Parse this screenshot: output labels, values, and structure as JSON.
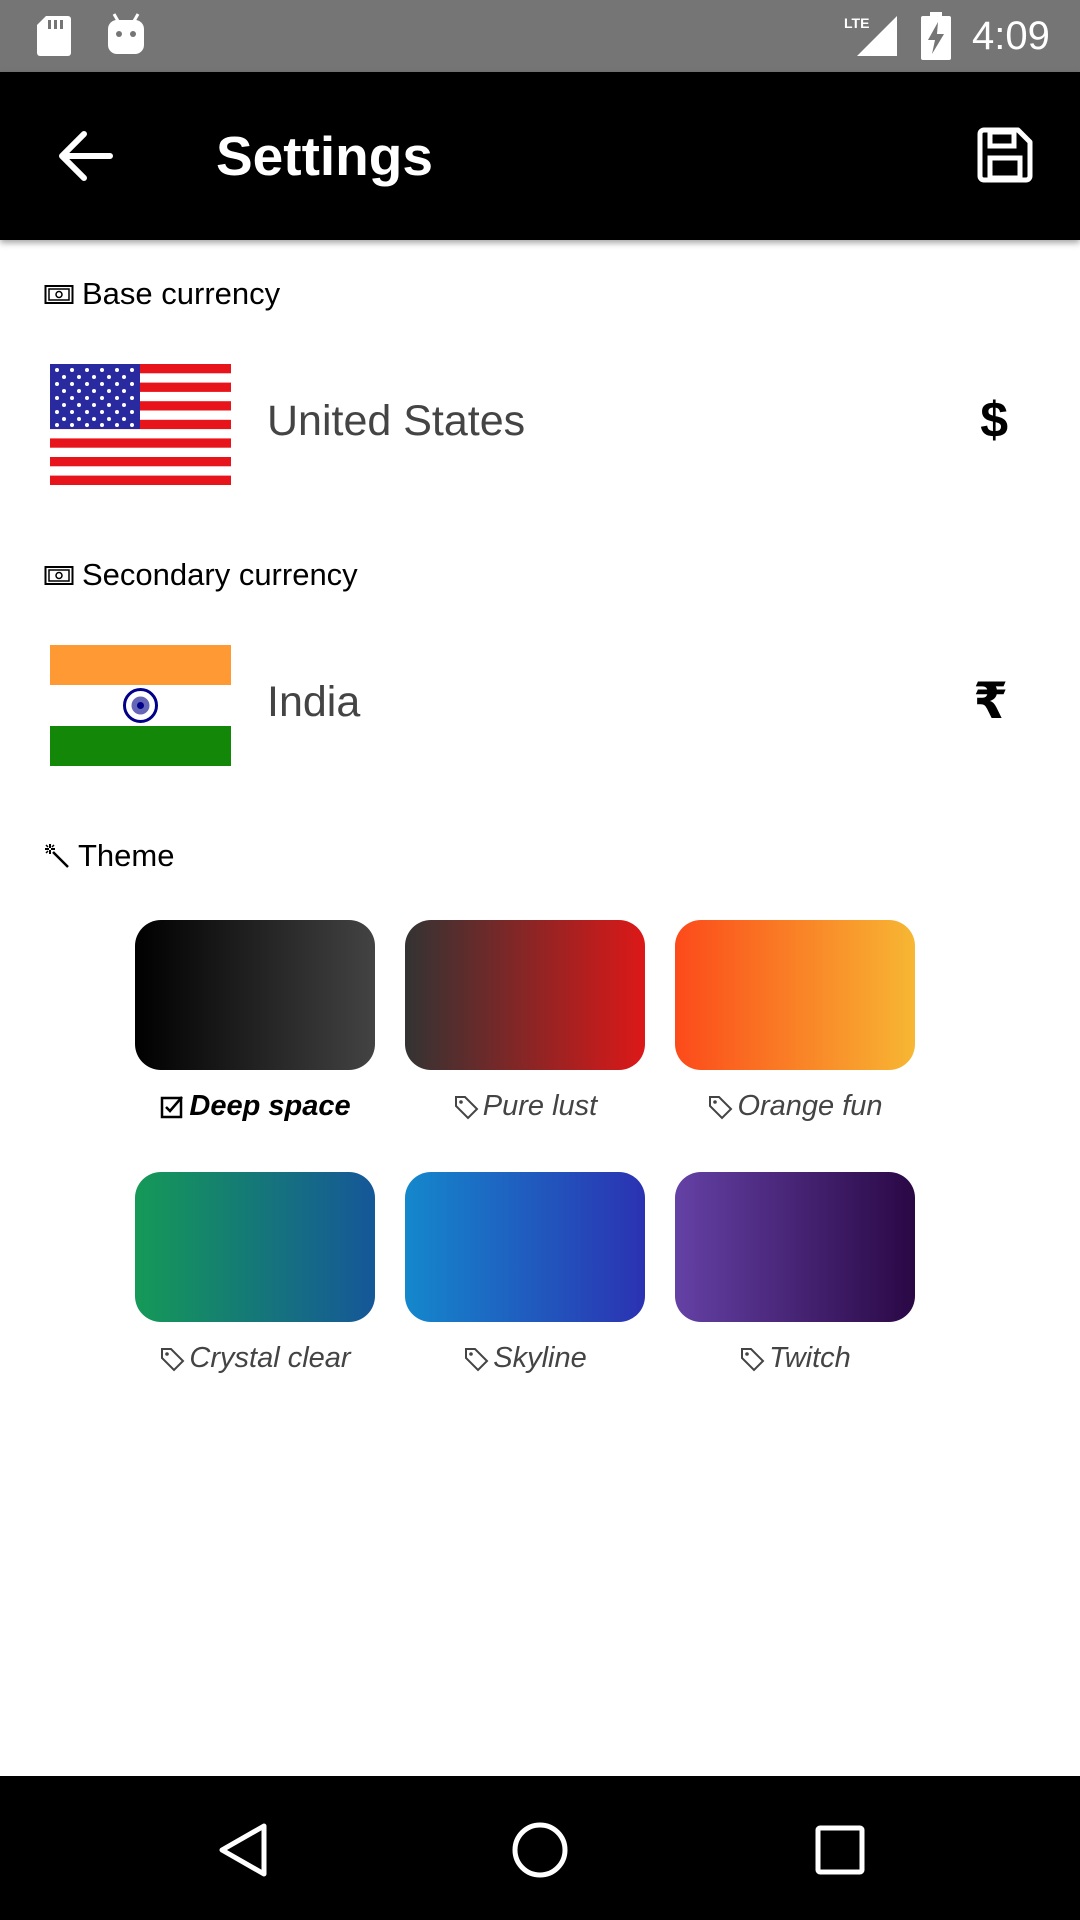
{
  "status_bar": {
    "time": "4:09",
    "network": "LTE",
    "icons": [
      "sd-card-icon",
      "android-icon",
      "lte-signal-icon",
      "battery-charging-icon"
    ]
  },
  "app_bar": {
    "title": "Settings",
    "back_icon": "arrow-back-icon",
    "save_icon": "save-icon"
  },
  "base_currency": {
    "label": "Base currency",
    "icon": "money-icon",
    "country": "United States",
    "symbol": "$",
    "flag": "us-flag"
  },
  "secondary_currency": {
    "label": "Secondary currency",
    "icon": "money-icon",
    "country": "India",
    "symbol": "₹",
    "flag": "india-flag"
  },
  "theme": {
    "label": "Theme",
    "icon": "magic-wand-icon",
    "items": [
      {
        "name": "Deep space",
        "selected": true,
        "from": "#000000",
        "to": "#434343"
      },
      {
        "name": "Pure lust",
        "selected": false,
        "from": "#333333",
        "to": "#dd1818"
      },
      {
        "name": "Orange fun",
        "selected": false,
        "from": "#fc4a1a",
        "to": "#f7b733"
      },
      {
        "name": "Crystal clear",
        "selected": false,
        "from": "#159957",
        "to": "#155799"
      },
      {
        "name": "Skyline",
        "selected": false,
        "from": "#1488cc",
        "to": "#2b32b2"
      },
      {
        "name": "Twitch",
        "selected": false,
        "from": "#6441a5",
        "to": "#2a0845"
      }
    ]
  },
  "nav_bar": {
    "icons": [
      "back-triangle-icon",
      "home-circle-icon",
      "recents-square-icon"
    ]
  }
}
